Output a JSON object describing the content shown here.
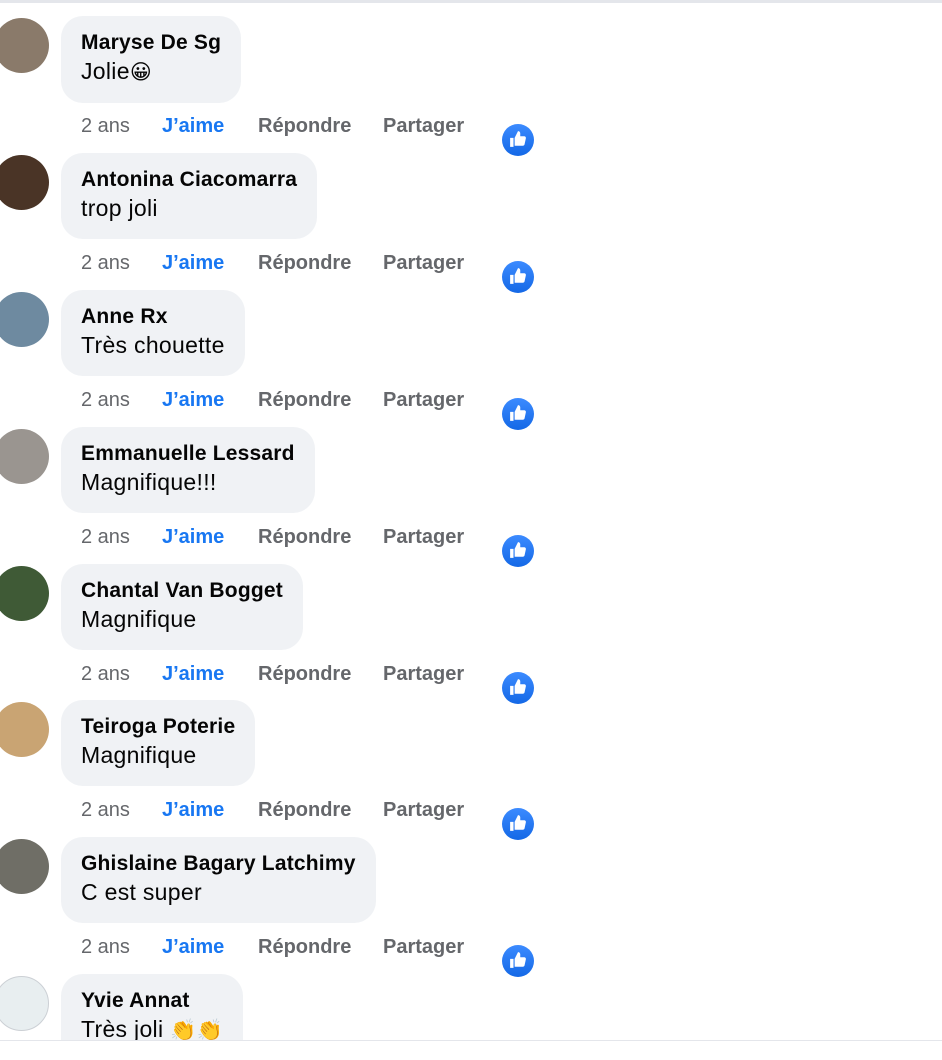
{
  "comments": [
    {
      "author": "Maryse De Sg",
      "text": "Jolie",
      "emoji": "😀",
      "time": "2 ans",
      "like": "J’aime",
      "reply": "Répondre",
      "share": "Partager",
      "avatar_color": "#8a7a6a"
    },
    {
      "author": "Antonina Ciacomarra",
      "text": "trop joli",
      "emoji": "",
      "time": "2 ans",
      "like": "J’aime",
      "reply": "Répondre",
      "share": "Partager",
      "avatar_color": "#4a3426"
    },
    {
      "author": "Anne Rx",
      "text": "Très chouette",
      "emoji": "",
      "time": "2 ans",
      "like": "J’aime",
      "reply": "Répondre",
      "share": "Partager",
      "avatar_color": "#6e8aa0"
    },
    {
      "author": "Emmanuelle Lessard",
      "text": "Magnifique!!!",
      "emoji": "",
      "time": "2 ans",
      "like": "J’aime",
      "reply": "Répondre",
      "share": "Partager",
      "avatar_color": "#9a9590"
    },
    {
      "author": "Chantal Van Bogget",
      "text": "Magnifique",
      "emoji": "",
      "time": "2 ans",
      "like": "J’aime",
      "reply": "Répondre",
      "share": "Partager",
      "avatar_color": "#3f5a36"
    },
    {
      "author": "Teiroga Poterie",
      "text": "Magnifique",
      "emoji": "",
      "time": "2 ans",
      "like": "J’aime",
      "reply": "Répondre",
      "share": "Partager",
      "avatar_color": "#c9a473"
    },
    {
      "author": "Ghislaine Bagary Latchimy",
      "text": "C est super",
      "emoji": "",
      "time": "2 ans",
      "like": "J’aime",
      "reply": "Répondre",
      "share": "Partager",
      "avatar_color": "#6f6e66"
    },
    {
      "author": "Yvie Annat",
      "text": "Très joli",
      "emoji": "👏👏",
      "time": "",
      "like": "",
      "reply": "",
      "share": "",
      "avatar_color": "#e8eef0"
    }
  ],
  "colors": {
    "bubble": "#f0f2f5",
    "like_active": "#1877f2",
    "meta": "#65676b",
    "text": "#050505"
  }
}
